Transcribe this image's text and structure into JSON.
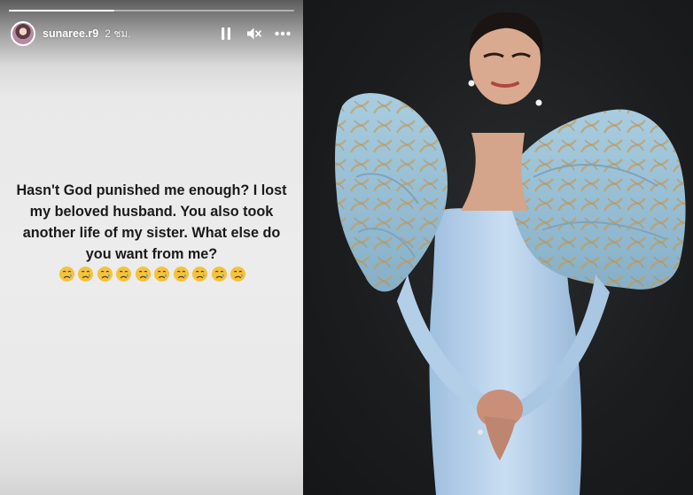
{
  "story": {
    "progress_fraction": 0.37,
    "username": "sunaree.r9",
    "timestamp": "2 ชม.",
    "icons": [
      "pause-icon",
      "mute-icon",
      "more-icon"
    ],
    "text": "Hasn't God punished me enough? I lost my beloved husband. You also took another life of my sister. What else do you want from me?",
    "emoji_name": "crying-face",
    "emoji_count": 10
  },
  "photo": {
    "description_icon": "woman-in-blue-gown-photo",
    "colors": {
      "background": "#1c1d1f",
      "dress": "#b9d3ec",
      "sleeve": "#9ec3d8",
      "gold": "#c69a55",
      "skin": "#d7a98e",
      "hair": "#1a1412"
    }
  }
}
